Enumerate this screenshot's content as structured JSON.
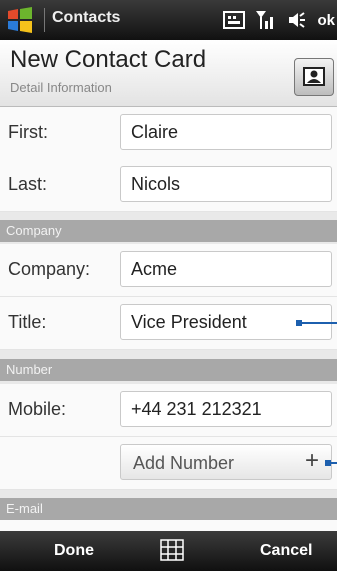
{
  "status_bar": {
    "app_title": "Contacts",
    "icons": [
      "keyboard-icon",
      "signal-icon",
      "volume-icon",
      "ok-button"
    ],
    "ok_label": "ok"
  },
  "header": {
    "title": "New Contact Card",
    "subtitle": "Detail Information"
  },
  "fields": {
    "first": {
      "label": "First:",
      "value": "Claire"
    },
    "last": {
      "label": "Last:",
      "value": "Nicols"
    },
    "company": {
      "label": "Company:",
      "value": "Acme"
    },
    "title": {
      "label": "Title:",
      "value": "Vice President"
    },
    "mobile": {
      "label": "Mobile:",
      "value": "+44 231 212321"
    }
  },
  "sections": {
    "company": "Company",
    "number": "Number",
    "email": "E-mail"
  },
  "add_number": {
    "label": "Add Number",
    "plus": "+"
  },
  "softkeys": {
    "left": "Done",
    "right": "Cancel"
  },
  "colors": {
    "callout": "#1c5fae",
    "section_bg": "#a8a8a8"
  }
}
